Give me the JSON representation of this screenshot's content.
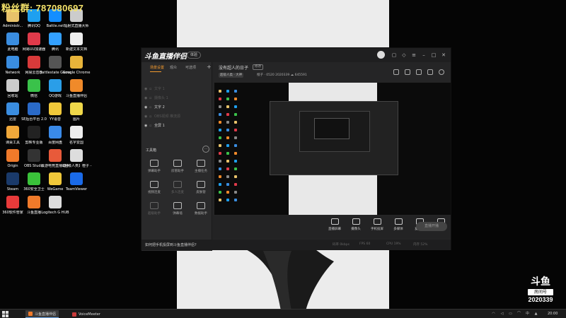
{
  "overlay": {
    "fan_group": "粉丝群: 787080697"
  },
  "desktop_icons": [
    {
      "label": "Administr...",
      "color": "#e8c26a"
    },
    {
      "label": "腾讯QQ",
      "color": "#1ea0f0"
    },
    {
      "label": "Battle.net",
      "color": "#148eff"
    },
    {
      "label": "辐射式直播大师",
      "color": "#cccccc"
    },
    {
      "label": "此电脑",
      "color": "#3a8de0"
    },
    {
      "label": "网易UU加速器",
      "color": "#e03a4a"
    },
    {
      "label": "腾讯",
      "color": "#33a0ff"
    },
    {
      "label": "新建文本文档",
      "color": "#eeeeee"
    },
    {
      "label": "Network",
      "color": "#3a8de0"
    },
    {
      "label": "网易云音乐",
      "color": "#d83a3a"
    },
    {
      "label": "Battlestate Games L...",
      "color": "#555555"
    },
    {
      "label": "Google Chrome",
      "color": "#e8b43a"
    },
    {
      "label": "回收站",
      "color": "#cccccc"
    },
    {
      "label": "微信",
      "color": "#3ac24a"
    },
    {
      "label": "QQ游戏",
      "color": "#2a9ee8"
    },
    {
      "label": "斗鱼直播伴侣",
      "color": "#f08a2a"
    },
    {
      "label": "迅雷",
      "color": "#3a8de0"
    },
    {
      "label": "SE后台平台 2.0",
      "color": "#2a6ac8"
    },
    {
      "label": "YY语音",
      "color": "#f0c83a"
    },
    {
      "label": "图片",
      "color": "#f0d84a"
    },
    {
      "label": "课桌工具",
      "color": "#f0a83a"
    },
    {
      "label": "剪映专业版",
      "color": "#222222"
    },
    {
      "label": "百度网盘",
      "color": "#3a8ae8"
    },
    {
      "label": "名字爱国",
      "color": "#eeeeee"
    },
    {
      "label": "Origin",
      "color": "#f07a2a"
    },
    {
      "label": "OBS Studio",
      "color": "#333333"
    },
    {
      "label": "云游电竞直播助手",
      "color": "#e85a3a"
    },
    {
      "label": "【超级人类】橙子 - 052...",
      "color": "#dddddd"
    },
    {
      "label": "Steam",
      "color": "#1a3a6a"
    },
    {
      "label": "360安全卫士",
      "color": "#3ac23a"
    },
    {
      "label": "WeGame",
      "color": "#f0c83a"
    },
    {
      "label": "TeamViewer",
      "color": "#1a6ae8"
    },
    {
      "label": "360软件管家",
      "color": "#e83a3a"
    },
    {
      "label": "斗鱼直播",
      "color": "#f07a2a"
    },
    {
      "label": "Logitech G HUB",
      "color": "#dddddd"
    }
  ],
  "app": {
    "logo_text": "斗鱼直播伴侣",
    "version_badge": "体验",
    "tabs": [
      "场景设置",
      "观众",
      "可选项"
    ],
    "add_icon": "+",
    "sources": [
      {
        "label": "文字 1",
        "on": false
      },
      {
        "label": "摄像头 1",
        "on": false
      },
      {
        "label": "文字 2",
        "on": true
      },
      {
        "label": "OBS视频 推流源",
        "on": false
      },
      {
        "label": "全屏 1",
        "on": true
      }
    ],
    "toolbox_label": "工具箱",
    "tools": [
      {
        "label": "弹幕助手",
        "dim": false
      },
      {
        "label": "房管助手",
        "dim": false
      },
      {
        "label": "主播任务",
        "dim": false
      },
      {
        "label": "视频连麦",
        "dim": false
      },
      {
        "label": "多人连麦",
        "dim": true
      },
      {
        "label": "皮肤管",
        "dim": false
      },
      {
        "label": "超级助手",
        "dim": true
      },
      {
        "label": "弹幕墙",
        "dim": false
      },
      {
        "label": "数据助手",
        "dim": false
      }
    ],
    "room": {
      "title": "没有超人的日子",
      "change_label": "修改",
      "category": "超级人类 · 大神",
      "meta": "橙子 · 0520   2020339   ☁ 645591"
    },
    "bottom_buttons": [
      "直播屏幕",
      "摄像头",
      "手机投屏",
      "多媒体",
      "麦克风",
      "扬声器"
    ],
    "start_live": "直播开播",
    "status_tip": "如何把手机投屏到斗鱼直播伴侣?",
    "status_stats": [
      "码率 0kbps",
      "FPS 60",
      "CPU 19%",
      "内存 52%"
    ]
  },
  "watermark": {
    "logo": "斗鱼",
    "label": "房间号",
    "room": "2020339"
  },
  "taskbar": {
    "items": [
      {
        "label": "斗鱼直播伴侣",
        "active": true,
        "color": "#f07a2a"
      },
      {
        "label": "VoiceMeeter",
        "active": false,
        "color": "#c83a3a"
      }
    ],
    "clock": "20:00"
  }
}
